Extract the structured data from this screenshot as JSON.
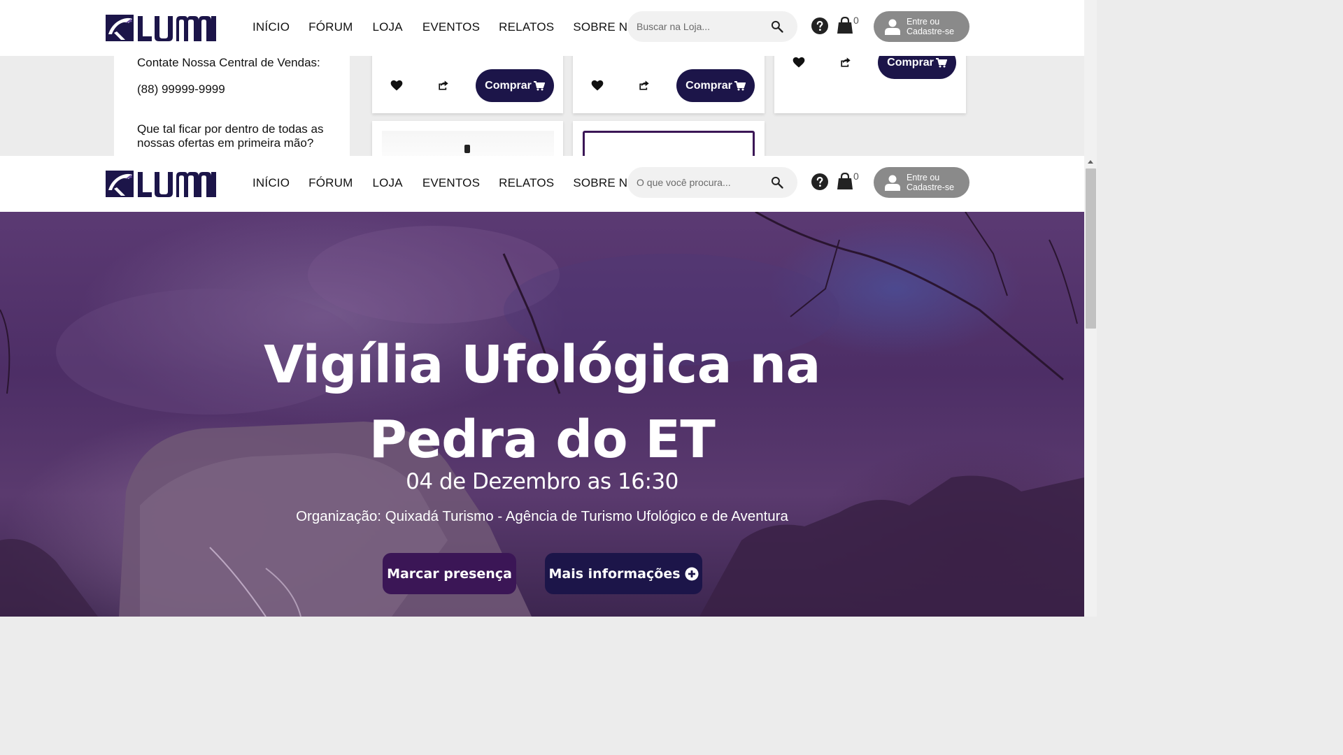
{
  "brand": {
    "logo_text": "LUMNI",
    "primary_color": "#1c1549",
    "accent_purple": "#3b1656"
  },
  "nav": {
    "items": [
      "INÍCIO",
      "FÓRUM",
      "LOJA",
      "EVENTOS",
      "RELATOS",
      "SOBRE NÓS"
    ]
  },
  "store_header": {
    "search_placeholder": "Buscar na Loja...",
    "cart_count": "0",
    "login_line1": "Entre ou",
    "login_line2": "Cadastre-se"
  },
  "event_header": {
    "search_placeholder": "O que você procura...",
    "cart_count": "0",
    "login_line1": "Entre ou",
    "login_line2": "Cadastre-se"
  },
  "store": {
    "contact_title": "Contate Nossa Central de Vendas:",
    "contact_phone": "(88) 99999-9999",
    "newsletter_line1": "Que tal ficar por dentro de todas as",
    "newsletter_line2": "nossas ofertas em primeira mão?",
    "buy_label": "Comprar"
  },
  "event": {
    "title_line1": "Vigília Ufológica na",
    "title_line2": "Pedra do ET",
    "date": "04 de Dezembro as 16:30",
    "organizer": "Organização: Quixadá Turismo - Agência de Turismo Ufológico e de Aventura",
    "presence_label": "Marcar presença",
    "more_info_label": "Mais informações"
  },
  "icons": [
    "search-icon",
    "help-icon",
    "cart-icon",
    "user-icon",
    "heart-icon",
    "share-icon",
    "cart-small-icon",
    "plus-circle-icon"
  ]
}
